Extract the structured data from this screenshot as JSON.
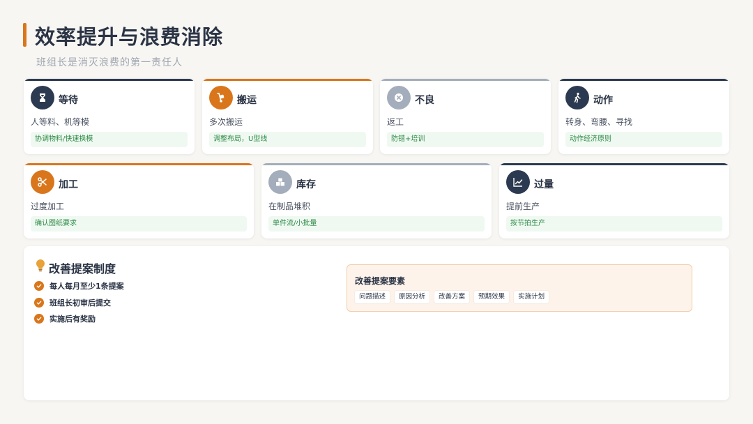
{
  "page": {
    "title": "效率提升与浪费消除",
    "subtitle": "班组长是消灭浪费的第一责任人"
  },
  "wastes": [
    {
      "name": "等待",
      "desc": "人等料、机等模",
      "solution": "协调物料/快速换模",
      "icon": "hourglass-icon",
      "color": "#2b3a50"
    },
    {
      "name": "搬运",
      "desc": "多次搬运",
      "solution": "调整布局，U型线",
      "icon": "hand-truck-icon",
      "color": "#d9761c"
    },
    {
      "name": "不良",
      "desc": "返工",
      "solution": "防错+培训",
      "icon": "close-circle-icon",
      "color": "#a4adbb"
    },
    {
      "name": "动作",
      "desc": "转身、弯腰、寻找",
      "solution": "动作经济原则",
      "icon": "walking-person-icon",
      "color": "#2b3a50"
    },
    {
      "name": "加工",
      "desc": "过度加工",
      "solution": "确认图纸要求",
      "icon": "scissors-icon",
      "color": "#d9761c"
    },
    {
      "name": "库存",
      "desc": "在制品堆积",
      "solution": "单件流/小批量",
      "icon": "boxes-icon",
      "color": "#a4adbb"
    },
    {
      "name": "过量",
      "desc": "提前生产",
      "solution": "按节拍生产",
      "icon": "line-chart-icon",
      "color": "#2b3a50"
    }
  ],
  "proposal": {
    "title": "改善提案制度",
    "title_icon": "lightbulb-icon",
    "rules": [
      "每人每月至少1条提案",
      "班组长初审后提交",
      "实施后有奖励"
    ],
    "elements_title": "改善提案要素",
    "elements": [
      "问题描述",
      "原因分析",
      "改善方案",
      "预期效果",
      "实施计划"
    ]
  },
  "colors": {
    "accent": "#d9761c",
    "navy": "#2b3a50",
    "gray": "#a4adbb",
    "success": "#2e8a47"
  }
}
